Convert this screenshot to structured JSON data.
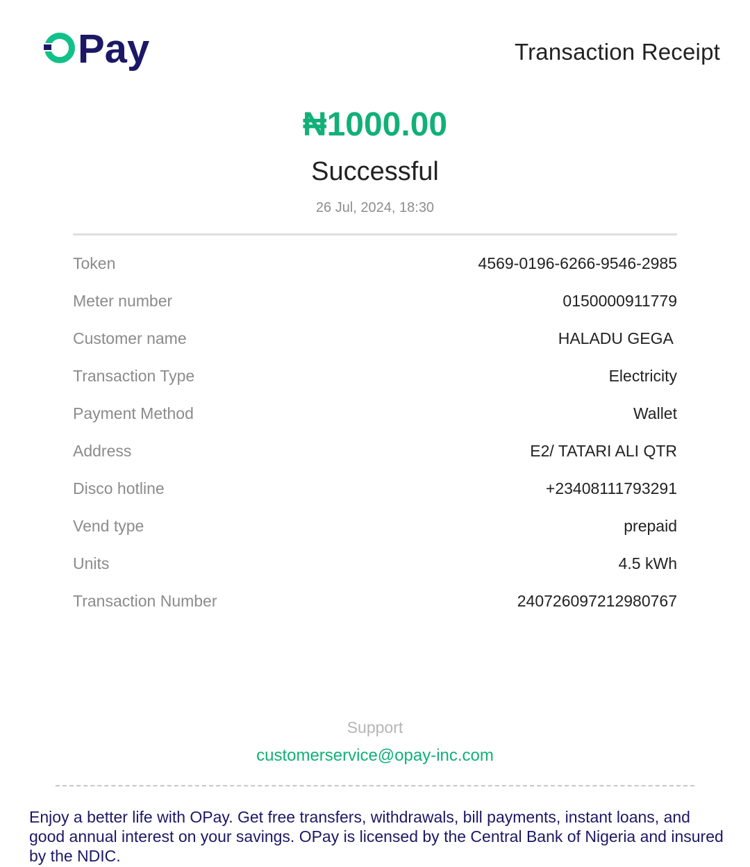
{
  "header": {
    "logo_text": "OPay",
    "title": "Transaction Receipt"
  },
  "summary": {
    "amount": "₦1000.00",
    "status": "Successful",
    "datetime": "26 Jul, 2024, 18:30"
  },
  "details": [
    {
      "label": "Token",
      "value": "4569-0196-6266-9546-2985"
    },
    {
      "label": "Meter number",
      "value": "0150000911779"
    },
    {
      "label": "Customer name",
      "value": "HALADU GEGA "
    },
    {
      "label": "Transaction Type",
      "value": "Electricity"
    },
    {
      "label": "Payment Method",
      "value": "Wallet"
    },
    {
      "label": "Address",
      "value": "E2/ TATARI ALI QTR"
    },
    {
      "label": "Disco hotline",
      "value": "+23408111793291"
    },
    {
      "label": "Vend type",
      "value": "prepaid"
    },
    {
      "label": "Units",
      "value": "4.5 kWh"
    },
    {
      "label": "Transaction Number",
      "value": "240726097212980767"
    }
  ],
  "support": {
    "label": "Support",
    "email": "customerservice@opay-inc.com"
  },
  "footer": {
    "text": "Enjoy a better life with OPay. Get free transfers, withdrawals, bill payments, instant loans, and good annual interest on your savings. OPay is licensed by the Central Bank of Nigeria and insured by the NDIC."
  },
  "colors": {
    "brand_green": "#12b078",
    "brand_navy": "#1c1866",
    "label_gray": "#8b8b8b"
  }
}
